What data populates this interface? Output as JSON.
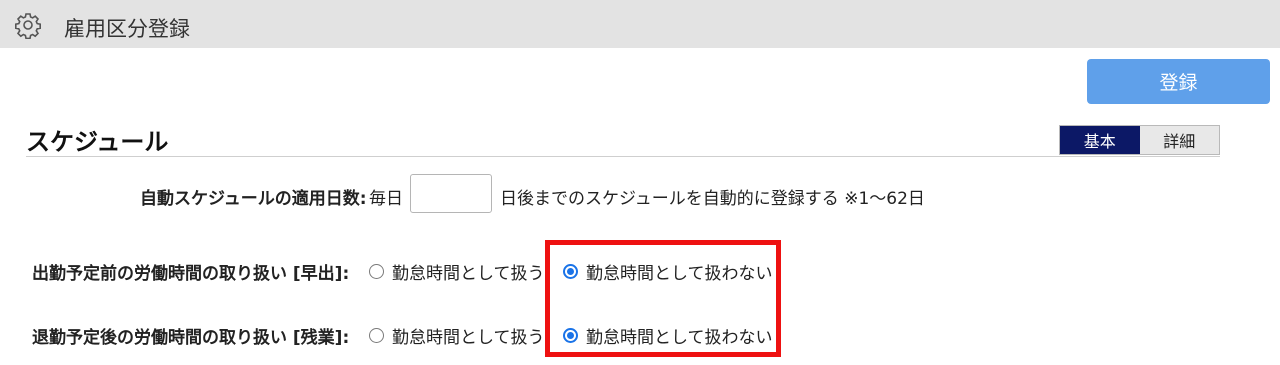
{
  "header": {
    "title": "雇用区分登録",
    "icon": "gear-icon"
  },
  "toolbar": {
    "register_label": "登録"
  },
  "section": {
    "title": "スケジュール",
    "view_toggle": {
      "basic_label": "基本",
      "detail_label": "詳細",
      "selected": "基本"
    }
  },
  "auto_schedule": {
    "label": "自動スケジュールの適用日数:",
    "prefix": "毎日",
    "value": "",
    "suffix": "日後までのスケジュールを自動的に登録する ※1～62日"
  },
  "early_work": {
    "label": "出勤予定前の労働時間の取り扱い [早出]:",
    "option_treat": "勤怠時間として扱う",
    "option_not_treat": "勤怠時間として扱わない",
    "selected": "勤怠時間として扱わない"
  },
  "overtime": {
    "label": "退勤予定後の労働時間の取り扱い [残業]:",
    "option_treat": "勤怠時間として扱う",
    "option_not_treat": "勤怠時間として扱わない",
    "selected": "勤怠時間として扱わない"
  },
  "colors": {
    "titlebar_bg": "#e3e3e3",
    "register_button": "#5fa0ea",
    "toggle_active": "#0c1866",
    "radio_selected": "#1a73e8",
    "highlight": "#ee1111"
  }
}
